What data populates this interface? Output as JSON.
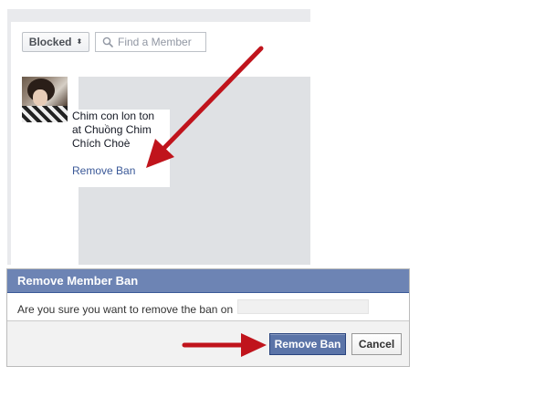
{
  "filter": {
    "selected": "Blocked",
    "caret": "⬍",
    "search_placeholder": "Find a Member"
  },
  "member": {
    "name": "Chim con lon ton at Chuồng Chim Chích Choè",
    "action": "Remove Ban"
  },
  "dialog": {
    "title": "Remove Member Ban",
    "message": "Are you sure you want to remove the ban on",
    "confirm_label": "Remove Ban",
    "cancel_label": "Cancel"
  },
  "colors": {
    "header_bg": "#6d84b4",
    "link": "#3b5998",
    "primary_button": "#5b74a8",
    "arrow": "#c0141c",
    "panel_bg": "#e9eaed"
  }
}
